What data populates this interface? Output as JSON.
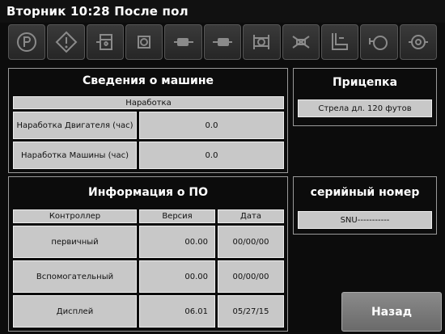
{
  "header": {
    "title": "Вторник 10:28 После пол"
  },
  "icons": [
    "parking-icon",
    "warning-icon",
    "fluid-level-icon",
    "engine-icon",
    "hydraulic-icon",
    "hydraulic-pump-icon",
    "fan-icon",
    "filter-icon",
    "pressure-icon",
    "motor-icon",
    "gear-pump-icon"
  ],
  "machine": {
    "title": "Сведения о машине",
    "hours_header": "Наработка",
    "engine_label": "Наработка Двигателя (час)",
    "engine_value": "0.0",
    "machine_label": "Наработка Машины (час)",
    "machine_value": "0.0"
  },
  "hitch": {
    "title": "Прицепка",
    "value": "Стрела дл. 120 футов"
  },
  "software": {
    "title": "Информация о ПО",
    "headers": [
      "Контроллер",
      "Версия",
      "Дата"
    ],
    "rows": [
      {
        "controller": "первичный",
        "version": "00.00",
        "date": "00/00/00"
      },
      {
        "controller": "Вспомогательный",
        "version": "00.00",
        "date": "00/00/00"
      },
      {
        "controller": "Дисплей",
        "version": "06.01",
        "date": "05/27/15"
      }
    ]
  },
  "serial": {
    "title": "серийный номер",
    "value": "SNU-----------"
  },
  "back_label": "Назад"
}
